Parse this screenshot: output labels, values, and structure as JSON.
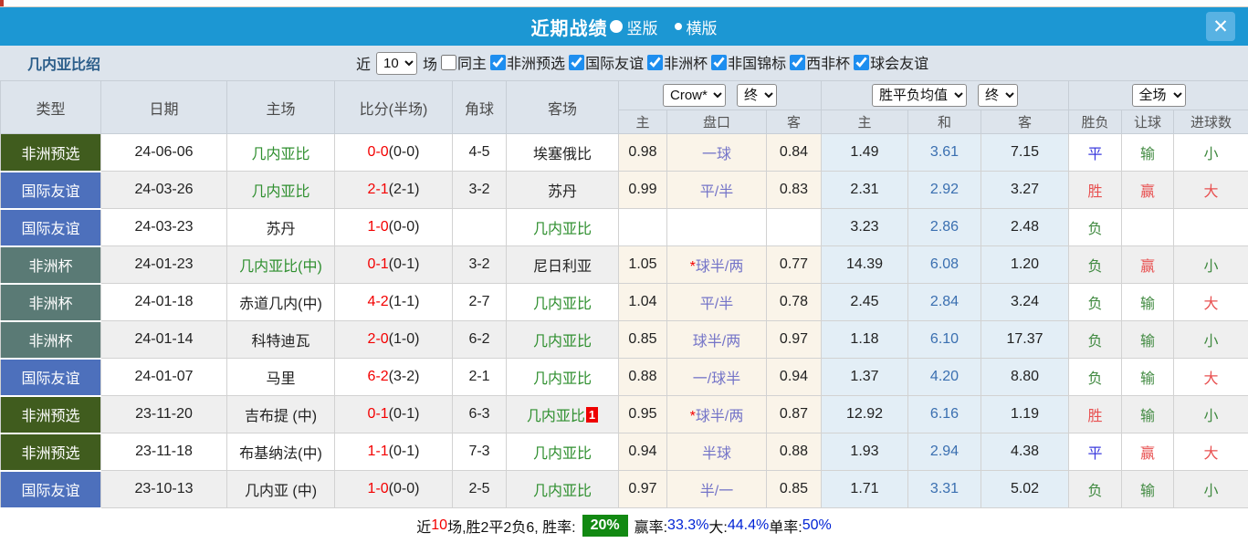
{
  "header": {
    "title": "近期战绩",
    "view_options": [
      {
        "label": "竖版",
        "selected": true
      },
      {
        "label": "横版",
        "selected": false
      }
    ],
    "close_label": "✕"
  },
  "filters": {
    "team_name": "几内亚比绍",
    "near_label": "近",
    "matches_count": "10",
    "field_label": "场",
    "checkboxes": [
      {
        "label": "同主",
        "checked": false
      },
      {
        "label": "非洲预选",
        "checked": true
      },
      {
        "label": "国际友谊",
        "checked": true
      },
      {
        "label": "非洲杯",
        "checked": true
      },
      {
        "label": "非国锦标",
        "checked": true
      },
      {
        "label": "西非杯",
        "checked": true
      },
      {
        "label": "球会友谊",
        "checked": true
      }
    ]
  },
  "table": {
    "left_headers": [
      "类型",
      "日期",
      "主场",
      "比分(半场)",
      "角球",
      "客场"
    ],
    "dropdowns": {
      "asia_company": "Crow*",
      "asia_time": "终",
      "europe_label": "胜平负均值",
      "europe_time": "终",
      "result_scope": "全场"
    },
    "sub_headers": [
      "主",
      "盘口",
      "客",
      "主",
      "和",
      "客",
      "胜负",
      "让球",
      "进球数"
    ],
    "type_colors": {
      "qualifier": "#405c1e",
      "friendly": "#4d70bc",
      "cup": "#5a7a75"
    },
    "result_colors": {
      "win": "#e85050",
      "draw": "#3b3bdd",
      "lose": "#418a41"
    },
    "rows": [
      {
        "type": "非洲预选",
        "type_key": "qualifier",
        "date": "24-06-06",
        "home": "几内亚比",
        "home_green": true,
        "score_ft": "0-0",
        "score_ht": "(0-0)",
        "corner": "4-5",
        "away": "埃塞俄比",
        "away_green": false,
        "away_badge": "",
        "asia_home": "0.98",
        "handicap": "一球",
        "handicap_star": false,
        "asia_away": "0.84",
        "eu_home": "1.49",
        "eu_draw": "3.61",
        "eu_away": "7.15",
        "result": {
          "text": "平",
          "key": "draw"
        },
        "handicap_result": {
          "text": "输",
          "key": "lose"
        },
        "goals": {
          "text": "小",
          "key": "lose"
        }
      },
      {
        "type": "国际友谊",
        "type_key": "friendly",
        "date": "24-03-26",
        "home": "几内亚比",
        "home_green": true,
        "score_ft": "2-1",
        "score_ht": "(2-1)",
        "corner": "3-2",
        "away": "苏丹",
        "away_green": false,
        "away_badge": "",
        "asia_home": "0.99",
        "handicap": "平/半",
        "handicap_star": false,
        "asia_away": "0.83",
        "eu_home": "2.31",
        "eu_draw": "2.92",
        "eu_away": "3.27",
        "result": {
          "text": "胜",
          "key": "win"
        },
        "handicap_result": {
          "text": "赢",
          "key": "win"
        },
        "goals": {
          "text": "大",
          "key": "win"
        }
      },
      {
        "type": "国际友谊",
        "type_key": "friendly",
        "date": "24-03-23",
        "home": "苏丹",
        "home_green": false,
        "score_ft": "1-0",
        "score_ht": "(0-0)",
        "corner": "",
        "away": "几内亚比",
        "away_green": true,
        "away_badge": "",
        "asia_home": "",
        "handicap": "",
        "handicap_star": false,
        "asia_away": "",
        "eu_home": "3.23",
        "eu_draw": "2.86",
        "eu_away": "2.48",
        "result": {
          "text": "负",
          "key": "lose"
        },
        "handicap_result": {
          "text": "",
          "key": ""
        },
        "goals": {
          "text": "",
          "key": ""
        }
      },
      {
        "type": "非洲杯",
        "type_key": "cup",
        "date": "24-01-23",
        "home": "几内亚比(中)",
        "home_green": true,
        "score_ft": "0-1",
        "score_ht": "(0-1)",
        "corner": "3-2",
        "away": "尼日利亚",
        "away_green": false,
        "away_badge": "",
        "asia_home": "1.05",
        "handicap": "球半/两",
        "handicap_star": true,
        "asia_away": "0.77",
        "eu_home": "14.39",
        "eu_draw": "6.08",
        "eu_away": "1.20",
        "result": {
          "text": "负",
          "key": "lose"
        },
        "handicap_result": {
          "text": "赢",
          "key": "win"
        },
        "goals": {
          "text": "小",
          "key": "lose"
        }
      },
      {
        "type": "非洲杯",
        "type_key": "cup",
        "date": "24-01-18",
        "home": "赤道几内(中)",
        "home_green": false,
        "score_ft": "4-2",
        "score_ht": "(1-1)",
        "corner": "2-7",
        "away": "几内亚比",
        "away_green": true,
        "away_badge": "",
        "asia_home": "1.04",
        "handicap": "平/半",
        "handicap_star": false,
        "asia_away": "0.78",
        "eu_home": "2.45",
        "eu_draw": "2.84",
        "eu_away": "3.24",
        "result": {
          "text": "负",
          "key": "lose"
        },
        "handicap_result": {
          "text": "输",
          "key": "lose"
        },
        "goals": {
          "text": "大",
          "key": "win"
        }
      },
      {
        "type": "非洲杯",
        "type_key": "cup",
        "date": "24-01-14",
        "home": "科特迪瓦",
        "home_green": false,
        "score_ft": "2-0",
        "score_ht": "(1-0)",
        "corner": "6-2",
        "away": "几内亚比",
        "away_green": true,
        "away_badge": "",
        "asia_home": "0.85",
        "handicap": "球半/两",
        "handicap_star": false,
        "asia_away": "0.97",
        "eu_home": "1.18",
        "eu_draw": "6.10",
        "eu_away": "17.37",
        "result": {
          "text": "负",
          "key": "lose"
        },
        "handicap_result": {
          "text": "输",
          "key": "lose"
        },
        "goals": {
          "text": "小",
          "key": "lose"
        }
      },
      {
        "type": "国际友谊",
        "type_key": "friendly",
        "date": "24-01-07",
        "home": "马里",
        "home_green": false,
        "score_ft": "6-2",
        "score_ht": "(3-2)",
        "corner": "2-1",
        "away": "几内亚比",
        "away_green": true,
        "away_badge": "",
        "asia_home": "0.88",
        "handicap": "一/球半",
        "handicap_star": false,
        "asia_away": "0.94",
        "eu_home": "1.37",
        "eu_draw": "4.20",
        "eu_away": "8.80",
        "result": {
          "text": "负",
          "key": "lose"
        },
        "handicap_result": {
          "text": "输",
          "key": "lose"
        },
        "goals": {
          "text": "大",
          "key": "win"
        }
      },
      {
        "type": "非洲预选",
        "type_key": "qualifier",
        "date": "23-11-20",
        "home": "吉布提 (中)",
        "home_green": false,
        "score_ft": "0-1",
        "score_ht": "(0-1)",
        "corner": "6-3",
        "away": "几内亚比",
        "away_green": true,
        "away_badge": "1",
        "asia_home": "0.95",
        "handicap": "球半/两",
        "handicap_star": true,
        "asia_away": "0.87",
        "eu_home": "12.92",
        "eu_draw": "6.16",
        "eu_away": "1.19",
        "result": {
          "text": "胜",
          "key": "win"
        },
        "handicap_result": {
          "text": "输",
          "key": "lose"
        },
        "goals": {
          "text": "小",
          "key": "lose"
        }
      },
      {
        "type": "非洲预选",
        "type_key": "qualifier",
        "date": "23-11-18",
        "home": "布基纳法(中)",
        "home_green": false,
        "score_ft": "1-1",
        "score_ht": "(0-1)",
        "corner": "7-3",
        "away": "几内亚比",
        "away_green": true,
        "away_badge": "",
        "asia_home": "0.94",
        "handicap": "半球",
        "handicap_star": false,
        "asia_away": "0.88",
        "eu_home": "1.93",
        "eu_draw": "2.94",
        "eu_away": "4.38",
        "result": {
          "text": "平",
          "key": "draw"
        },
        "handicap_result": {
          "text": "赢",
          "key": "win"
        },
        "goals": {
          "text": "大",
          "key": "win"
        }
      },
      {
        "type": "国际友谊",
        "type_key": "friendly",
        "date": "23-10-13",
        "home": "几内亚 (中)",
        "home_green": false,
        "score_ft": "1-0",
        "score_ht": "(0-0)",
        "corner": "2-5",
        "away": "几内亚比",
        "away_green": true,
        "away_badge": "",
        "asia_home": "0.97",
        "handicap": "半/一",
        "handicap_star": false,
        "asia_away": "0.85",
        "eu_home": "1.71",
        "eu_draw": "3.31",
        "eu_away": "5.02",
        "result": {
          "text": "负",
          "key": "lose"
        },
        "handicap_result": {
          "text": "输",
          "key": "lose"
        },
        "goals": {
          "text": "小",
          "key": "lose"
        }
      }
    ]
  },
  "summary": {
    "segments": [
      {
        "text": "近",
        "style": "black"
      },
      {
        "text": "10",
        "style": "red"
      },
      {
        "text": "场,胜2平2负6, 胜率:",
        "style": "black"
      },
      {
        "text": "20%",
        "style": "badge"
      },
      {
        "text": "赢率:",
        "style": "black"
      },
      {
        "text": "33.3%",
        "style": "blue"
      },
      {
        "text": " 大:",
        "style": "black"
      },
      {
        "text": "44.4%",
        "style": "blue"
      },
      {
        "text": " 单率:",
        "style": "black"
      },
      {
        "text": "50%",
        "style": "blue"
      }
    ]
  }
}
